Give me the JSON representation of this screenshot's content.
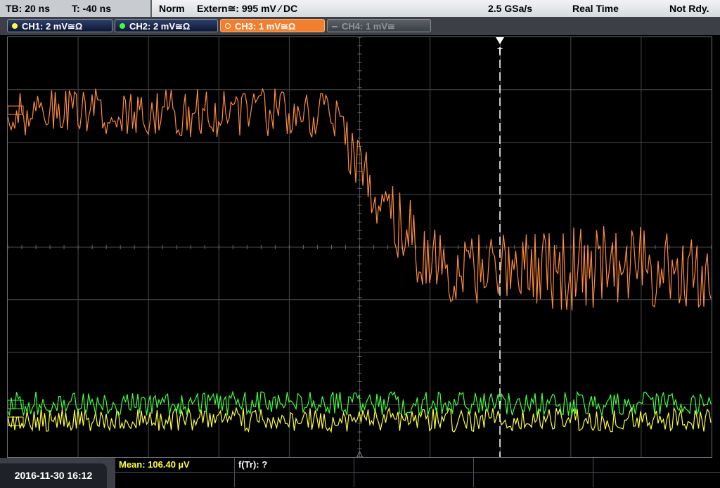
{
  "status": {
    "timebase": "TB: 20 ns",
    "trigger_time": "T: -40 ns",
    "mode": "Norm",
    "trigger_source": "Extern≅: 995 mV ⁄ DC",
    "sample_rate": "2.5 GSa/s",
    "acq_mode": "Real Time",
    "state": "Not Rdy."
  },
  "channels": [
    {
      "label": "CH1: 2 mV≅Ω",
      "color": "#ffff40"
    },
    {
      "label": "CH2: 2 mV≅Ω",
      "color": "#40ff40"
    },
    {
      "label": "CH3: 1 mV≅Ω",
      "color": "#ff8c3c"
    },
    {
      "label": "CH4: 1 mV≅",
      "color": "#8e949b"
    }
  ],
  "screen": {
    "trigger_marker": "T",
    "ch3_marker": "3"
  },
  "bottom": {
    "datetime": "2016-11-30 16:12",
    "mean_label": "Mean: 106.40 µV",
    "ftr_label": "f(Tr): ?"
  },
  "colors": {
    "ch1": "#ffff40",
    "ch2": "#40ff40",
    "ch3": "#ff8c3c",
    "grid": "#4a4a4a",
    "trigger_line": "#ffffff"
  }
}
